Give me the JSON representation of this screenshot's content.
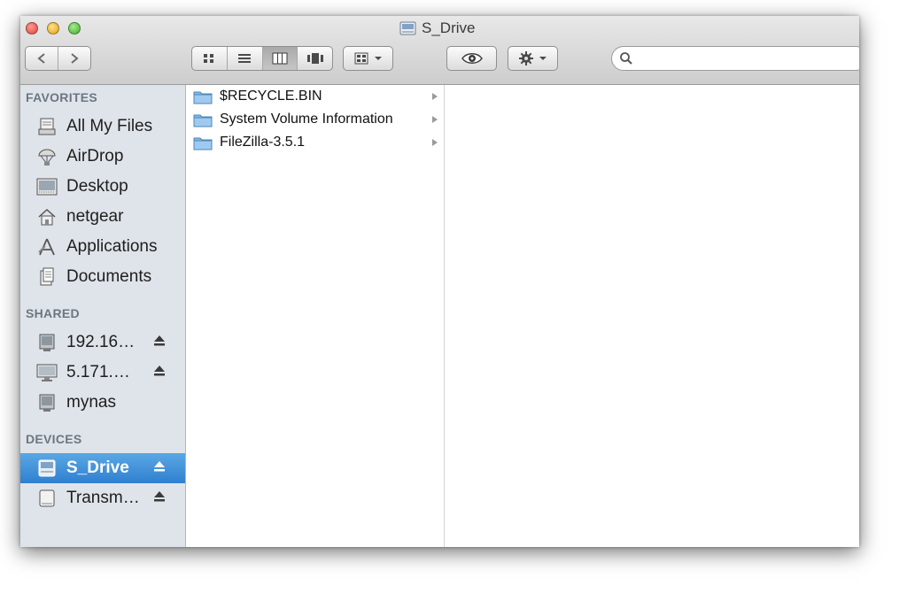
{
  "window": {
    "title": "S_Drive"
  },
  "toolbar": {
    "back_forward": {
      "back_icon": "back-arrow-icon",
      "forward_icon": "forward-arrow-icon"
    },
    "view_modes": [
      "icon-view",
      "list-view",
      "column-view",
      "cover-flow-view"
    ],
    "active_view": "column-view",
    "arrange_icon": "arrange-grid-icon",
    "quick_look_icon": "eye-icon",
    "action_icon": "gear-icon",
    "search": {
      "placeholder": "",
      "value": ""
    }
  },
  "sidebar": {
    "favorites_header": "FAVORITES",
    "favorites": [
      {
        "label": "All My Files",
        "icon": "all-my-files-icon"
      },
      {
        "label": "AirDrop",
        "icon": "airdrop-icon"
      },
      {
        "label": "Desktop",
        "icon": "desktop-icon"
      },
      {
        "label": "netgear",
        "icon": "home-icon"
      },
      {
        "label": "Applications",
        "icon": "applications-icon"
      },
      {
        "label": "Documents",
        "icon": "documents-icon"
      }
    ],
    "shared_header": "SHARED",
    "shared": [
      {
        "label": "192.16…",
        "icon": "server-icon",
        "eject": true
      },
      {
        "label": "5.171.…",
        "icon": "monitor-icon",
        "eject": true
      },
      {
        "label": "mynas",
        "icon": "server-icon",
        "eject": false
      }
    ],
    "devices_header": "DEVICES",
    "devices": [
      {
        "label": "S_Drive",
        "icon": "network-drive-icon",
        "eject": true,
        "selected": true
      },
      {
        "label": "Transm…",
        "icon": "disk-icon",
        "eject": true,
        "selected": false
      }
    ]
  },
  "columns": {
    "first": [
      {
        "name": "$RECYCLE.BIN"
      },
      {
        "name": "System Volume Information"
      },
      {
        "name": "FileZilla-3.5.1"
      }
    ]
  },
  "colors": {
    "selection": "#3d8fd9",
    "sidebar_bg": "#dfe4ea",
    "folder": "#7fb8e6"
  }
}
